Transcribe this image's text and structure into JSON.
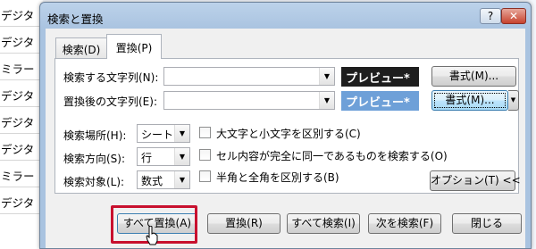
{
  "background": {
    "cells": [
      "デジタ",
      "デジタ",
      "ミラー",
      "デジタ",
      "デジタ",
      "デジタ",
      "ミラー",
      "デジタ"
    ]
  },
  "dialog": {
    "title": "検索と置換",
    "help_label": "?",
    "close_label": "✕"
  },
  "tabs": [
    {
      "label": "検索(D)"
    },
    {
      "label": "置換(P)"
    }
  ],
  "fields": {
    "find_label": "検索する文字列(N):",
    "find_value": "",
    "replace_label": "置換後の文字列(E):",
    "replace_value": "",
    "preview_find": "プレビュー*",
    "preview_replace": "プレビュー*",
    "format_find": "書式(M)...",
    "format_replace": "書式(M)..."
  },
  "options": {
    "within_label": "検索場所(H):",
    "within_value": "シート",
    "search_label": "検索方向(S):",
    "search_value": "行",
    "lookin_label": "検索対象(L):",
    "lookin_value": "数式",
    "match_case": "大文字と小文字を区別する(C)",
    "match_entire": "セル内容が完全に同一であるものを検索する(O)",
    "match_byte": "半角と全角を区別する(B)",
    "options_button": "オプション(T) <<"
  },
  "buttons": {
    "replace_all": "すべて置換(A)",
    "replace": "置換(R)",
    "find_all": "すべて検索(I)",
    "find_next": "次を検索(F)",
    "close": "閉じる"
  },
  "colors": {
    "highlight": "#c8102e",
    "preview_dark": "#1e1e1e",
    "preview_light": "#6ea0d8"
  }
}
